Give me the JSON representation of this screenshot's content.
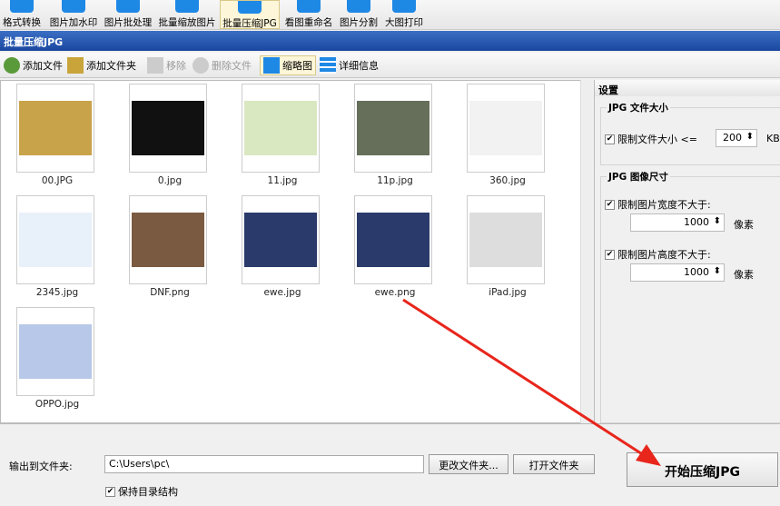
{
  "topbar": {
    "items": [
      "格式转换",
      "图片加水印",
      "图片批处理",
      "批量缩放图片",
      "批量压缩JPG",
      "看图重命名",
      "图片分割",
      "大图打印"
    ],
    "active": 4
  },
  "window_title": "批量压缩JPG",
  "toolbar": {
    "add_file": "添加文件",
    "add_folder": "添加文件夹",
    "remove": "移除",
    "delete_file": "删除文件",
    "thumbnail": "缩略图",
    "details": "详细信息"
  },
  "files": [
    "00.JPG",
    "0.jpg",
    "11.jpg",
    "11p.jpg",
    "360.jpg",
    "2345.jpg",
    "DNF.png",
    "ewe.jpg",
    "ewe.png",
    "iPad.jpg",
    "OPPO.jpg"
  ],
  "thumb_colors": [
    "#c9a34a",
    "#111111",
    "#d9e8c0",
    "#666f5a",
    "#f2f2f2",
    "#e8f0fa",
    "#7a5a40",
    "#2a3a6a",
    "#2a3a6a",
    "#dddddd",
    "#b8c8e8"
  ],
  "settings": {
    "title": "设置",
    "size_group": "JPG 文件大小",
    "limit_size": "限制文件大小 <=",
    "size_value": "200",
    "size_unit": "KB",
    "dim_group": "JPG 图像尺寸",
    "limit_width": "限制图片宽度不大于:",
    "width_value": "1000",
    "limit_height": "限制图片高度不大于:",
    "height_value": "1000",
    "px_unit": "像素",
    "check": "✔"
  },
  "output": {
    "label": "输出到文件夹:",
    "path": "C:\\Users\\pc\\",
    "change": "更改文件夹...",
    "open": "打开文件夹",
    "keep_structure": "保持目录结构",
    "start": "开始压缩JPG"
  },
  "colors": {
    "accent": "#1a47a0",
    "arrow": "#e8261c"
  }
}
